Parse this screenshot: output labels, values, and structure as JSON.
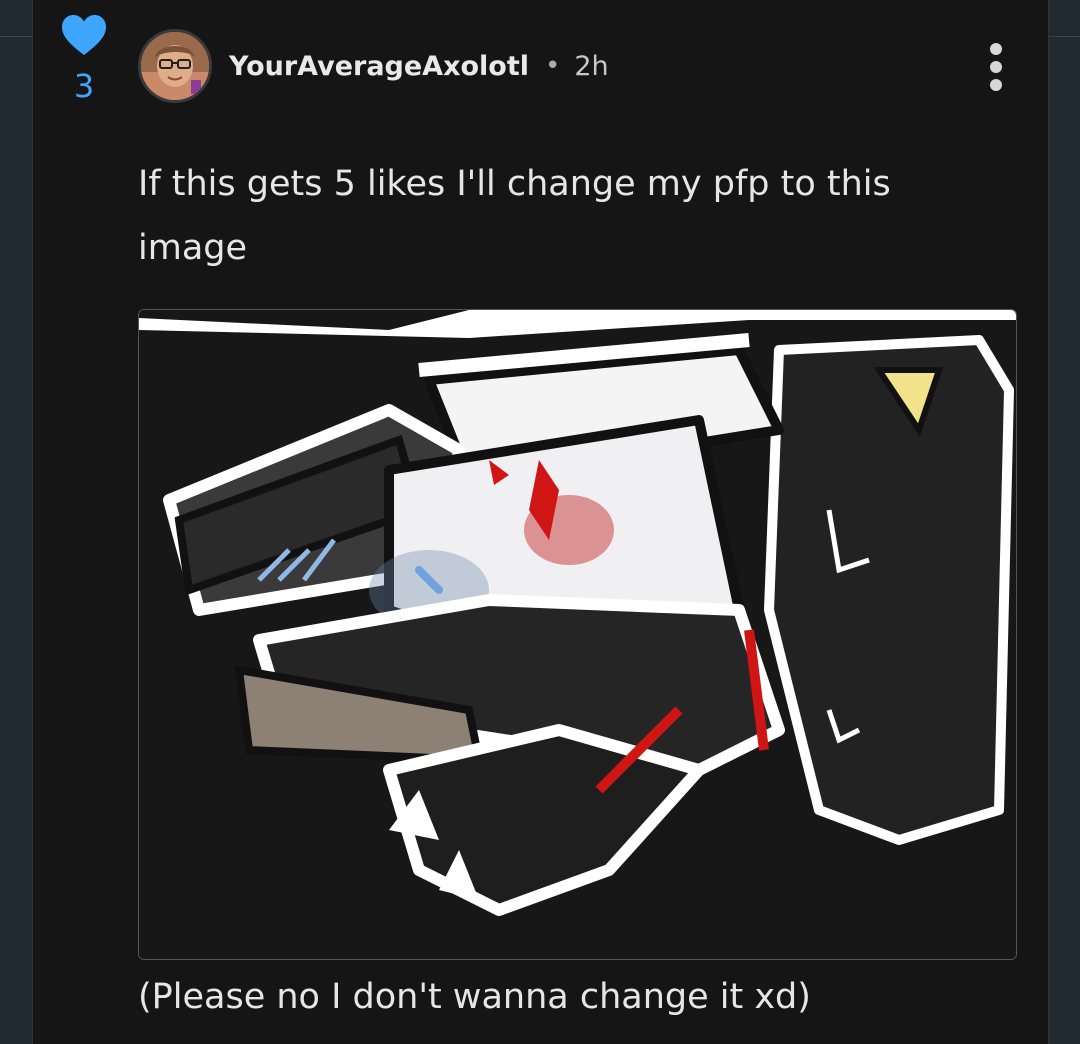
{
  "post": {
    "like_count": "3",
    "author": "YourAverageAxolotl",
    "separator": "•",
    "time": "2h",
    "body": "If this gets 5 likes I'll change my pfp to this image",
    "caption": "(Please no I don't wanna change it xd)"
  },
  "colors": {
    "accent": "#3ea6ff",
    "card_bg": "#151515",
    "page_bg": "#1f2a31",
    "text": "#e6e6e6"
  },
  "icons": {
    "like": "heart-icon",
    "menu": "more-vertical-icon"
  }
}
